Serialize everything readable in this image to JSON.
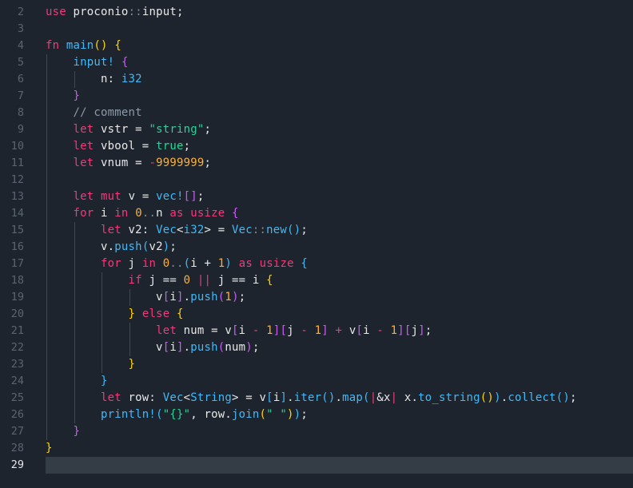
{
  "editor": {
    "first_line_number": 2,
    "active_line": 29,
    "lines": [
      [
        [
          "kw",
          "use"
        ],
        [
          "id",
          " proconio"
        ],
        [
          "punc",
          "::"
        ],
        [
          "id",
          "input;"
        ]
      ],
      [],
      [
        [
          "kw",
          "fn"
        ],
        [
          "id",
          " "
        ],
        [
          "fn",
          "main"
        ],
        [
          "br1",
          "()"
        ],
        [
          "id",
          " "
        ],
        [
          "br1",
          "{"
        ]
      ],
      [
        [
          "id",
          "    "
        ],
        [
          "mac",
          "input!"
        ],
        [
          "id",
          " "
        ],
        [
          "br2",
          "{"
        ]
      ],
      [
        [
          "id",
          "        n: "
        ],
        [
          "ty",
          "i32"
        ]
      ],
      [
        [
          "id",
          "    "
        ],
        [
          "br2",
          "}"
        ]
      ],
      [
        [
          "id",
          "    "
        ],
        [
          "cm",
          "// comment"
        ]
      ],
      [
        [
          "id",
          "    "
        ],
        [
          "kw",
          "let"
        ],
        [
          "id",
          " vstr = "
        ],
        [
          "str",
          "\"string\""
        ],
        [
          "id",
          ";"
        ]
      ],
      [
        [
          "id",
          "    "
        ],
        [
          "kw",
          "let"
        ],
        [
          "id",
          " vbool = "
        ],
        [
          "bool",
          "true"
        ],
        [
          "id",
          ";"
        ]
      ],
      [
        [
          "id",
          "    "
        ],
        [
          "kw",
          "let"
        ],
        [
          "id",
          " vnum = "
        ],
        [
          "kw",
          "-"
        ],
        [
          "num",
          "9999999"
        ],
        [
          "id",
          ";"
        ]
      ],
      [],
      [
        [
          "id",
          "    "
        ],
        [
          "kw",
          "let"
        ],
        [
          "id",
          " "
        ],
        [
          "kw",
          "mut"
        ],
        [
          "id",
          " v = "
        ],
        [
          "mac",
          "vec!"
        ],
        [
          "br2",
          "[]"
        ],
        [
          "id",
          ";"
        ]
      ],
      [
        [
          "id",
          "    "
        ],
        [
          "kw",
          "for"
        ],
        [
          "id",
          " i "
        ],
        [
          "kw",
          "in"
        ],
        [
          "id",
          " "
        ],
        [
          "num",
          "0"
        ],
        [
          "punc",
          ".."
        ],
        [
          "id",
          "n "
        ],
        [
          "kw",
          "as"
        ],
        [
          "id",
          " "
        ],
        [
          "kw",
          "usize"
        ],
        [
          "id",
          " "
        ],
        [
          "br2",
          "{"
        ]
      ],
      [
        [
          "id",
          "        "
        ],
        [
          "kw",
          "let"
        ],
        [
          "id",
          " v2: "
        ],
        [
          "ty",
          "Vec"
        ],
        [
          "id",
          "<"
        ],
        [
          "ty",
          "i32"
        ],
        [
          "id",
          "> = "
        ],
        [
          "ty",
          "Vec"
        ],
        [
          "punc",
          "::"
        ],
        [
          "fn",
          "new"
        ],
        [
          "br3",
          "()"
        ],
        [
          "id",
          ";"
        ]
      ],
      [
        [
          "id",
          "        v."
        ],
        [
          "fn",
          "push"
        ],
        [
          "br3",
          "("
        ],
        [
          "id",
          "v2"
        ],
        [
          "br3",
          ")"
        ],
        [
          "id",
          ";"
        ]
      ],
      [
        [
          "id",
          "        "
        ],
        [
          "kw",
          "for"
        ],
        [
          "id",
          " j "
        ],
        [
          "kw",
          "in"
        ],
        [
          "id",
          " "
        ],
        [
          "num",
          "0"
        ],
        [
          "punc",
          ".."
        ],
        [
          "br3",
          "("
        ],
        [
          "id",
          "i + "
        ],
        [
          "num",
          "1"
        ],
        [
          "br3",
          ")"
        ],
        [
          "id",
          " "
        ],
        [
          "kw",
          "as"
        ],
        [
          "id",
          " "
        ],
        [
          "kw",
          "usize"
        ],
        [
          "id",
          " "
        ],
        [
          "br3",
          "{"
        ]
      ],
      [
        [
          "id",
          "            "
        ],
        [
          "kw",
          "if"
        ],
        [
          "id",
          " j == "
        ],
        [
          "num",
          "0"
        ],
        [
          "id",
          " "
        ],
        [
          "kw",
          "||"
        ],
        [
          "id",
          " j == i "
        ],
        [
          "br1",
          "{"
        ]
      ],
      [
        [
          "id",
          "                v"
        ],
        [
          "br2",
          "["
        ],
        [
          "id",
          "i"
        ],
        [
          "br2",
          "]"
        ],
        [
          "id",
          "."
        ],
        [
          "fn",
          "push"
        ],
        [
          "br2",
          "("
        ],
        [
          "num",
          "1"
        ],
        [
          "br2",
          ")"
        ],
        [
          "id",
          ";"
        ]
      ],
      [
        [
          "id",
          "            "
        ],
        [
          "br1",
          "}"
        ],
        [
          "id",
          " "
        ],
        [
          "kw",
          "else"
        ],
        [
          "id",
          " "
        ],
        [
          "br1",
          "{"
        ]
      ],
      [
        [
          "id",
          "                "
        ],
        [
          "kw",
          "let"
        ],
        [
          "id",
          " num = v"
        ],
        [
          "br2",
          "["
        ],
        [
          "id",
          "i "
        ],
        [
          "kw",
          "-"
        ],
        [
          "id",
          " "
        ],
        [
          "num",
          "1"
        ],
        [
          "br2",
          "]["
        ],
        [
          "id",
          "j "
        ],
        [
          "kw",
          "-"
        ],
        [
          "id",
          " "
        ],
        [
          "num",
          "1"
        ],
        [
          "br2",
          "]"
        ],
        [
          "id",
          " "
        ],
        [
          "kw",
          "+"
        ],
        [
          "id",
          " v"
        ],
        [
          "br2",
          "["
        ],
        [
          "id",
          "i "
        ],
        [
          "kw",
          "-"
        ],
        [
          "id",
          " "
        ],
        [
          "num",
          "1"
        ],
        [
          "br2",
          "]["
        ],
        [
          "id",
          "j"
        ],
        [
          "br2",
          "]"
        ],
        [
          "id",
          ";"
        ]
      ],
      [
        [
          "id",
          "                v"
        ],
        [
          "br2",
          "["
        ],
        [
          "id",
          "i"
        ],
        [
          "br2",
          "]"
        ],
        [
          "id",
          "."
        ],
        [
          "fn",
          "push"
        ],
        [
          "br2",
          "("
        ],
        [
          "id",
          "num"
        ],
        [
          "br2",
          ")"
        ],
        [
          "id",
          ";"
        ]
      ],
      [
        [
          "id",
          "            "
        ],
        [
          "br1",
          "}"
        ]
      ],
      [
        [
          "id",
          "        "
        ],
        [
          "br3",
          "}"
        ]
      ],
      [
        [
          "id",
          "        "
        ],
        [
          "kw",
          "let"
        ],
        [
          "id",
          " row: "
        ],
        [
          "ty",
          "Vec"
        ],
        [
          "id",
          "<"
        ],
        [
          "ty",
          "String"
        ],
        [
          "id",
          "> = v"
        ],
        [
          "br3",
          "["
        ],
        [
          "id",
          "i"
        ],
        [
          "br3",
          "]"
        ],
        [
          "id",
          "."
        ],
        [
          "fn",
          "iter"
        ],
        [
          "br3",
          "()"
        ],
        [
          "id",
          "."
        ],
        [
          "fn",
          "map"
        ],
        [
          "br3",
          "("
        ],
        [
          "kw",
          "|"
        ],
        [
          "id",
          "&x"
        ],
        [
          "kw",
          "|"
        ],
        [
          "id",
          " x."
        ],
        [
          "fn",
          "to_string"
        ],
        [
          "br1",
          "()"
        ],
        [
          "br3",
          ")"
        ],
        [
          "id",
          "."
        ],
        [
          "fn",
          "collect"
        ],
        [
          "br3",
          "()"
        ],
        [
          "id",
          ";"
        ]
      ],
      [
        [
          "id",
          "        "
        ],
        [
          "mac",
          "println!"
        ],
        [
          "br3",
          "("
        ],
        [
          "str",
          "\"{}\""
        ],
        [
          "id",
          ", row."
        ],
        [
          "fn",
          "join"
        ],
        [
          "br1",
          "("
        ],
        [
          "str",
          "\" \""
        ],
        [
          "br1",
          ")"
        ],
        [
          "br3",
          ")"
        ],
        [
          "id",
          ";"
        ]
      ],
      [
        [
          "id",
          "    "
        ],
        [
          "br2",
          "}"
        ]
      ],
      [
        [
          "br1",
          "}"
        ]
      ],
      []
    ]
  },
  "colors": {
    "background": "#1d242d",
    "current_line": "#343c45",
    "keyword": "#f03a7b",
    "function": "#42b8f6",
    "number": "#ffb02e",
    "string": "#29d398",
    "comment": "#8c99a8"
  }
}
